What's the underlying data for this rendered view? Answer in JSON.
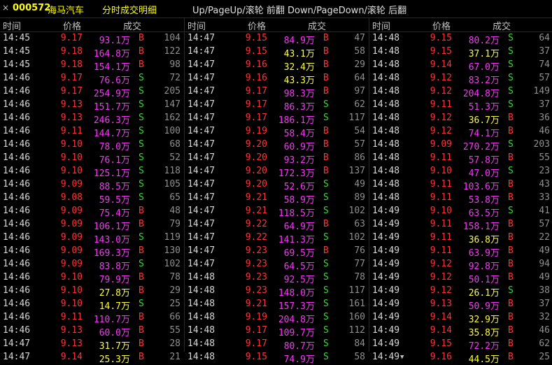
{
  "titlebar": {
    "close_glyph": "×",
    "code": "000572",
    "name": "海马汽车",
    "title": "分时成交明细",
    "hint": "Up/PageUp/滚轮 前翻 Down/PageDown/滚轮 后翻"
  },
  "headers": {
    "time": "时间",
    "price": "价格",
    "volume": "成交"
  },
  "colors": {
    "up": "#ff3333",
    "down": "#33dd33",
    "big": "#ff33ff",
    "small": "#ffff33"
  },
  "panels": [
    {
      "rows": [
        [
          "14:45",
          "9.17",
          "93.1万",
          "B",
          "104",
          "red",
          "magenta"
        ],
        [
          "14:45",
          "9.18",
          "164.8万",
          "B",
          "122",
          "red",
          "magenta"
        ],
        [
          "14:45",
          "9.18",
          "154.1万",
          "B",
          "98",
          "red",
          "magenta"
        ],
        [
          "14:46",
          "9.17",
          "76.6万",
          "S",
          "72",
          "red",
          "magenta"
        ],
        [
          "14:46",
          "9.17",
          "254.9万",
          "S",
          "205",
          "red",
          "magenta"
        ],
        [
          "14:46",
          "9.13",
          "151.7万",
          "S",
          "147",
          "red",
          "magenta"
        ],
        [
          "14:46",
          "9.13",
          "246.3万",
          "S",
          "162",
          "red",
          "magenta"
        ],
        [
          "14:46",
          "9.11",
          "144.7万",
          "S",
          "100",
          "red",
          "magenta"
        ],
        [
          "14:46",
          "9.10",
          "78.0万",
          "S",
          "68",
          "red",
          "magenta"
        ],
        [
          "14:46",
          "9.10",
          "76.1万",
          "S",
          "52",
          "red",
          "magenta"
        ],
        [
          "14:46",
          "9.10",
          "125.1万",
          "S",
          "118",
          "red",
          "magenta"
        ],
        [
          "14:46",
          "9.09",
          "88.5万",
          "S",
          "105",
          "red",
          "magenta"
        ],
        [
          "14:46",
          "9.08",
          "59.5万",
          "S",
          "65",
          "red",
          "magenta"
        ],
        [
          "14:46",
          "9.09",
          "75.4万",
          "B",
          "48",
          "red",
          "magenta"
        ],
        [
          "14:46",
          "9.09",
          "106.1万",
          "B",
          "79",
          "red",
          "magenta"
        ],
        [
          "14:46",
          "9.09",
          "143.0万",
          "S",
          "119",
          "red",
          "magenta"
        ],
        [
          "14:46",
          "9.09",
          "169.3万",
          "B",
          "130",
          "red",
          "magenta"
        ],
        [
          "14:46",
          "9.09",
          "83.8万",
          "S",
          "102",
          "red",
          "magenta"
        ],
        [
          "14:46",
          "9.10",
          "79.9万",
          "B",
          "78",
          "red",
          "magenta"
        ],
        [
          "14:46",
          "9.10",
          "27.8万",
          "B",
          "29",
          "red",
          "yellow"
        ],
        [
          "14:46",
          "9.10",
          "14.7万",
          "S",
          "25",
          "red",
          "yellow"
        ],
        [
          "14:46",
          "9.11",
          "110.7万",
          "B",
          "66",
          "red",
          "magenta"
        ],
        [
          "14:46",
          "9.13",
          "60.0万",
          "B",
          "55",
          "red",
          "magenta"
        ],
        [
          "14:47",
          "9.13",
          "31.7万",
          "B",
          "28",
          "red",
          "yellow"
        ],
        [
          "14:47",
          "9.14",
          "25.3万",
          "B",
          "21",
          "red",
          "yellow"
        ]
      ]
    },
    {
      "rows": [
        [
          "14:47",
          "9.15",
          "84.9万",
          "B",
          "47",
          "red",
          "magenta"
        ],
        [
          "14:47",
          "9.15",
          "43.1万",
          "B",
          "58",
          "red",
          "yellow"
        ],
        [
          "14:47",
          "9.16",
          "32.4万",
          "B",
          "29",
          "red",
          "yellow"
        ],
        [
          "14:47",
          "9.16",
          "43.3万",
          "B",
          "64",
          "red",
          "yellow"
        ],
        [
          "14:47",
          "9.17",
          "98.3万",
          "B",
          "97",
          "red",
          "magenta"
        ],
        [
          "14:47",
          "9.17",
          "86.3万",
          "S",
          "62",
          "red",
          "magenta"
        ],
        [
          "14:47",
          "9.17",
          "186.1万",
          "S",
          "117",
          "red",
          "magenta"
        ],
        [
          "14:47",
          "9.19",
          "58.4万",
          "B",
          "54",
          "red",
          "magenta"
        ],
        [
          "14:47",
          "9.20",
          "60.9万",
          "B",
          "57",
          "red",
          "magenta"
        ],
        [
          "14:47",
          "9.20",
          "93.2万",
          "B",
          "86",
          "red",
          "magenta"
        ],
        [
          "14:47",
          "9.20",
          "172.3万",
          "B",
          "137",
          "red",
          "magenta"
        ],
        [
          "14:47",
          "9.20",
          "52.6万",
          "S",
          "49",
          "red",
          "magenta"
        ],
        [
          "14:47",
          "9.21",
          "58.9万",
          "S",
          "89",
          "red",
          "magenta"
        ],
        [
          "14:47",
          "9.21",
          "118.5万",
          "S",
          "102",
          "red",
          "magenta"
        ],
        [
          "14:47",
          "9.22",
          "64.9万",
          "B",
          "63",
          "red",
          "magenta"
        ],
        [
          "14:47",
          "9.22",
          "141.3万",
          "S",
          "102",
          "red",
          "magenta"
        ],
        [
          "14:47",
          "9.23",
          "69.5万",
          "B",
          "76",
          "red",
          "magenta"
        ],
        [
          "14:47",
          "9.23",
          "64.5万",
          "S",
          "77",
          "red",
          "magenta"
        ],
        [
          "14:48",
          "9.23",
          "92.5万",
          "S",
          "78",
          "red",
          "magenta"
        ],
        [
          "14:48",
          "9.23",
          "148.0万",
          "S",
          "117",
          "red",
          "magenta"
        ],
        [
          "14:48",
          "9.21",
          "157.3万",
          "S",
          "161",
          "red",
          "magenta"
        ],
        [
          "14:48",
          "9.19",
          "204.8万",
          "S",
          "160",
          "red",
          "magenta"
        ],
        [
          "14:48",
          "9.17",
          "109.7万",
          "S",
          "112",
          "red",
          "magenta"
        ],
        [
          "14:48",
          "9.17",
          "80.7万",
          "S",
          "84",
          "red",
          "magenta"
        ],
        [
          "14:48",
          "9.15",
          "74.9万",
          "S",
          "58",
          "red",
          "magenta"
        ]
      ]
    },
    {
      "rows": [
        [
          "14:48",
          "9.15",
          "80.2万",
          "S",
          "64",
          "red",
          "magenta"
        ],
        [
          "14:48",
          "9.15",
          "37.1万",
          "S",
          "37",
          "red",
          "yellow"
        ],
        [
          "14:48",
          "9.14",
          "67.0万",
          "S",
          "74",
          "red",
          "magenta"
        ],
        [
          "14:48",
          "9.12",
          "83.2万",
          "S",
          "57",
          "red",
          "magenta"
        ],
        [
          "14:48",
          "9.12",
          "204.8万",
          "S",
          "149",
          "red",
          "magenta"
        ],
        [
          "14:48",
          "9.11",
          "51.3万",
          "S",
          "37",
          "red",
          "magenta"
        ],
        [
          "14:48",
          "9.12",
          "36.7万",
          "B",
          "36",
          "red",
          "yellow"
        ],
        [
          "14:48",
          "9.12",
          "74.1万",
          "B",
          "46",
          "red",
          "magenta"
        ],
        [
          "14:48",
          "9.09",
          "270.2万",
          "S",
          "203",
          "red",
          "magenta"
        ],
        [
          "14:48",
          "9.11",
          "57.8万",
          "B",
          "55",
          "red",
          "magenta"
        ],
        [
          "14:48",
          "9.10",
          "47.0万",
          "S",
          "23",
          "red",
          "magenta"
        ],
        [
          "14:48",
          "9.11",
          "103.6万",
          "B",
          "43",
          "red",
          "magenta"
        ],
        [
          "14:48",
          "9.11",
          "53.8万",
          "B",
          "33",
          "red",
          "magenta"
        ],
        [
          "14:49",
          "9.10",
          "63.5万",
          "S",
          "41",
          "red",
          "magenta"
        ],
        [
          "14:49",
          "9.11",
          "158.1万",
          "B",
          "57",
          "red",
          "magenta"
        ],
        [
          "14:49",
          "9.11",
          "36.8万",
          "B",
          "22",
          "red",
          "yellow"
        ],
        [
          "14:49",
          "9.11",
          "63.9万",
          "B",
          "49",
          "red",
          "magenta"
        ],
        [
          "14:49",
          "9.12",
          "92.8万",
          "B",
          "94",
          "red",
          "magenta"
        ],
        [
          "14:49",
          "9.12",
          "50.1万",
          "B",
          "49",
          "red",
          "magenta"
        ],
        [
          "14:49",
          "9.12",
          "26.1万",
          "S",
          "38",
          "red",
          "yellow"
        ],
        [
          "14:49",
          "9.13",
          "50.9万",
          "B",
          "37",
          "red",
          "magenta"
        ],
        [
          "14:49",
          "9.14",
          "32.9万",
          "B",
          "32",
          "red",
          "yellow"
        ],
        [
          "14:49",
          "9.14",
          "35.8万",
          "B",
          "46",
          "red",
          "yellow"
        ],
        [
          "14:49",
          "9.15",
          "72.2万",
          "B",
          "62",
          "red",
          "magenta"
        ],
        [
          "14:49",
          "9.16",
          "44.5万",
          "B",
          "25",
          "red",
          "yellow"
        ]
      ]
    }
  ],
  "last_row_marker": "▼"
}
